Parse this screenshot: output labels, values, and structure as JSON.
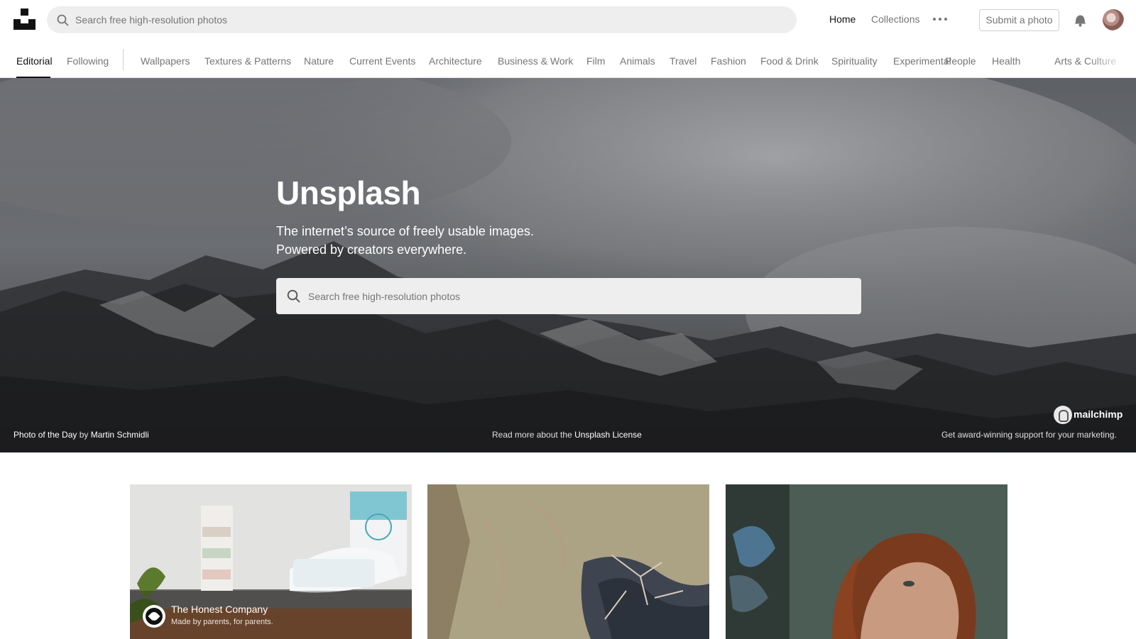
{
  "header": {
    "logo_icon": "unsplash-logo-icon",
    "search": {
      "placeholder": "Search free high-resolution photos",
      "value": ""
    },
    "nav": {
      "home": "Home",
      "collections": "Collections",
      "more_icon": "more-dots-icon"
    },
    "submit_label": "Submit a photo",
    "notification_icon": "bell-icon"
  },
  "topics": {
    "editorial": "Editorial",
    "following": "Following",
    "items": [
      "Wallpapers",
      "Textures & Patterns",
      "Nature",
      "Current Events",
      "Architecture",
      "Business & Work",
      "Film",
      "Animals",
      "Travel",
      "Fashion",
      "Food & Drink",
      "Spirituality",
      "Experimental",
      "People",
      "Health",
      "Arts & Culture"
    ]
  },
  "hero": {
    "title": "Unsplash",
    "subtitle_line1": "The internet’s source of freely usable images.",
    "subtitle_line2": "Powered by creators everywhere.",
    "search": {
      "placeholder": "Search free high-resolution photos",
      "value": ""
    },
    "photo_credit": {
      "label": "Photo of the Day",
      "by": "by",
      "author": "Martin Schmidli"
    },
    "license": {
      "prefix": "Read more about the",
      "link": "Unsplash License"
    },
    "sponsor": {
      "name": "mailchimp",
      "tagline": "Get award-winning support for your marketing."
    }
  },
  "grid": [
    {
      "kind": "sponsored",
      "brand": "The Honest Company",
      "tagline": "Made by parents, for parents."
    },
    {
      "kind": "photo"
    },
    {
      "kind": "photo"
    }
  ],
  "colors": {
    "text": "#111111",
    "muted": "#767676",
    "search_bg": "#eeeeee",
    "border": "#d1d1d1"
  }
}
